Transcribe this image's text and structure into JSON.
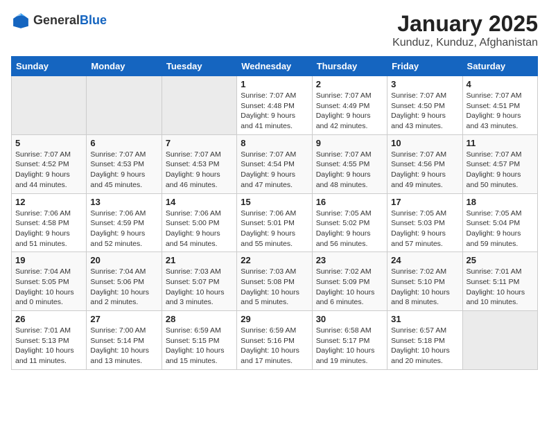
{
  "header": {
    "logo": {
      "general": "General",
      "blue": "Blue"
    },
    "title": "January 2025",
    "subtitle": "Kunduz, Kunduz, Afghanistan"
  },
  "calendar": {
    "weekdays": [
      "Sunday",
      "Monday",
      "Tuesday",
      "Wednesday",
      "Thursday",
      "Friday",
      "Saturday"
    ],
    "weeks": [
      [
        {
          "day": null,
          "sunrise": null,
          "sunset": null,
          "daylight": null
        },
        {
          "day": null,
          "sunrise": null,
          "sunset": null,
          "daylight": null
        },
        {
          "day": null,
          "sunrise": null,
          "sunset": null,
          "daylight": null
        },
        {
          "day": "1",
          "sunrise": "Sunrise: 7:07 AM",
          "sunset": "Sunset: 4:48 PM",
          "daylight": "Daylight: 9 hours and 41 minutes."
        },
        {
          "day": "2",
          "sunrise": "Sunrise: 7:07 AM",
          "sunset": "Sunset: 4:49 PM",
          "daylight": "Daylight: 9 hours and 42 minutes."
        },
        {
          "day": "3",
          "sunrise": "Sunrise: 7:07 AM",
          "sunset": "Sunset: 4:50 PM",
          "daylight": "Daylight: 9 hours and 43 minutes."
        },
        {
          "day": "4",
          "sunrise": "Sunrise: 7:07 AM",
          "sunset": "Sunset: 4:51 PM",
          "daylight": "Daylight: 9 hours and 43 minutes."
        }
      ],
      [
        {
          "day": "5",
          "sunrise": "Sunrise: 7:07 AM",
          "sunset": "Sunset: 4:52 PM",
          "daylight": "Daylight: 9 hours and 44 minutes."
        },
        {
          "day": "6",
          "sunrise": "Sunrise: 7:07 AM",
          "sunset": "Sunset: 4:53 PM",
          "daylight": "Daylight: 9 hours and 45 minutes."
        },
        {
          "day": "7",
          "sunrise": "Sunrise: 7:07 AM",
          "sunset": "Sunset: 4:53 PM",
          "daylight": "Daylight: 9 hours and 46 minutes."
        },
        {
          "day": "8",
          "sunrise": "Sunrise: 7:07 AM",
          "sunset": "Sunset: 4:54 PM",
          "daylight": "Daylight: 9 hours and 47 minutes."
        },
        {
          "day": "9",
          "sunrise": "Sunrise: 7:07 AM",
          "sunset": "Sunset: 4:55 PM",
          "daylight": "Daylight: 9 hours and 48 minutes."
        },
        {
          "day": "10",
          "sunrise": "Sunrise: 7:07 AM",
          "sunset": "Sunset: 4:56 PM",
          "daylight": "Daylight: 9 hours and 49 minutes."
        },
        {
          "day": "11",
          "sunrise": "Sunrise: 7:07 AM",
          "sunset": "Sunset: 4:57 PM",
          "daylight": "Daylight: 9 hours and 50 minutes."
        }
      ],
      [
        {
          "day": "12",
          "sunrise": "Sunrise: 7:06 AM",
          "sunset": "Sunset: 4:58 PM",
          "daylight": "Daylight: 9 hours and 51 minutes."
        },
        {
          "day": "13",
          "sunrise": "Sunrise: 7:06 AM",
          "sunset": "Sunset: 4:59 PM",
          "daylight": "Daylight: 9 hours and 52 minutes."
        },
        {
          "day": "14",
          "sunrise": "Sunrise: 7:06 AM",
          "sunset": "Sunset: 5:00 PM",
          "daylight": "Daylight: 9 hours and 54 minutes."
        },
        {
          "day": "15",
          "sunrise": "Sunrise: 7:06 AM",
          "sunset": "Sunset: 5:01 PM",
          "daylight": "Daylight: 9 hours and 55 minutes."
        },
        {
          "day": "16",
          "sunrise": "Sunrise: 7:05 AM",
          "sunset": "Sunset: 5:02 PM",
          "daylight": "Daylight: 9 hours and 56 minutes."
        },
        {
          "day": "17",
          "sunrise": "Sunrise: 7:05 AM",
          "sunset": "Sunset: 5:03 PM",
          "daylight": "Daylight: 9 hours and 57 minutes."
        },
        {
          "day": "18",
          "sunrise": "Sunrise: 7:05 AM",
          "sunset": "Sunset: 5:04 PM",
          "daylight": "Daylight: 9 hours and 59 minutes."
        }
      ],
      [
        {
          "day": "19",
          "sunrise": "Sunrise: 7:04 AM",
          "sunset": "Sunset: 5:05 PM",
          "daylight": "Daylight: 10 hours and 0 minutes."
        },
        {
          "day": "20",
          "sunrise": "Sunrise: 7:04 AM",
          "sunset": "Sunset: 5:06 PM",
          "daylight": "Daylight: 10 hours and 2 minutes."
        },
        {
          "day": "21",
          "sunrise": "Sunrise: 7:03 AM",
          "sunset": "Sunset: 5:07 PM",
          "daylight": "Daylight: 10 hours and 3 minutes."
        },
        {
          "day": "22",
          "sunrise": "Sunrise: 7:03 AM",
          "sunset": "Sunset: 5:08 PM",
          "daylight": "Daylight: 10 hours and 5 minutes."
        },
        {
          "day": "23",
          "sunrise": "Sunrise: 7:02 AM",
          "sunset": "Sunset: 5:09 PM",
          "daylight": "Daylight: 10 hours and 6 minutes."
        },
        {
          "day": "24",
          "sunrise": "Sunrise: 7:02 AM",
          "sunset": "Sunset: 5:10 PM",
          "daylight": "Daylight: 10 hours and 8 minutes."
        },
        {
          "day": "25",
          "sunrise": "Sunrise: 7:01 AM",
          "sunset": "Sunset: 5:11 PM",
          "daylight": "Daylight: 10 hours and 10 minutes."
        }
      ],
      [
        {
          "day": "26",
          "sunrise": "Sunrise: 7:01 AM",
          "sunset": "Sunset: 5:13 PM",
          "daylight": "Daylight: 10 hours and 11 minutes."
        },
        {
          "day": "27",
          "sunrise": "Sunrise: 7:00 AM",
          "sunset": "Sunset: 5:14 PM",
          "daylight": "Daylight: 10 hours and 13 minutes."
        },
        {
          "day": "28",
          "sunrise": "Sunrise: 6:59 AM",
          "sunset": "Sunset: 5:15 PM",
          "daylight": "Daylight: 10 hours and 15 minutes."
        },
        {
          "day": "29",
          "sunrise": "Sunrise: 6:59 AM",
          "sunset": "Sunset: 5:16 PM",
          "daylight": "Daylight: 10 hours and 17 minutes."
        },
        {
          "day": "30",
          "sunrise": "Sunrise: 6:58 AM",
          "sunset": "Sunset: 5:17 PM",
          "daylight": "Daylight: 10 hours and 19 minutes."
        },
        {
          "day": "31",
          "sunrise": "Sunrise: 6:57 AM",
          "sunset": "Sunset: 5:18 PM",
          "daylight": "Daylight: 10 hours and 20 minutes."
        },
        {
          "day": null,
          "sunrise": null,
          "sunset": null,
          "daylight": null
        }
      ]
    ]
  }
}
